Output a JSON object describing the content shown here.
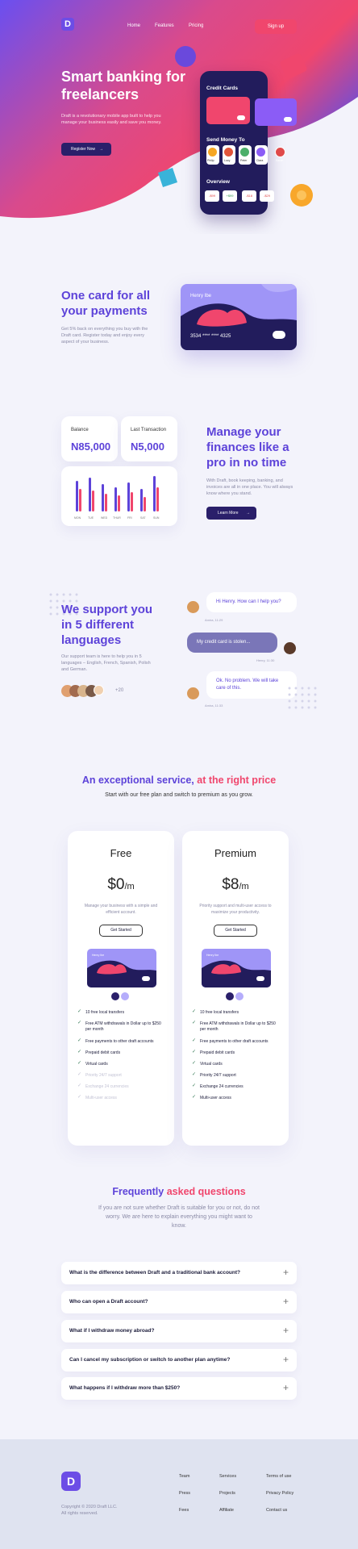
{
  "nav": {
    "logo": "D",
    "links": [
      "Home",
      "Features",
      "Pricing"
    ],
    "signup": "Sign up"
  },
  "hero": {
    "title": "Smart banking for freelancers",
    "desc": "Draft is a revolutionary mobile app built to help you manage your business easily and save you money.",
    "cta": "Register Now",
    "phone": {
      "credit_cards": "Credit Cards",
      "send_money": "Send Money To",
      "contacts": [
        "Philip",
        "Lucy",
        "Peter",
        "Clara",
        "Sarah"
      ],
      "overview": "Overview",
      "overview_vals": [
        "-$99",
        "+$99",
        "-$18",
        "-$29"
      ]
    }
  },
  "payments": {
    "title": "One card for all your payments",
    "desc": "Get 5% back on everything you buy with the Draft card. Register today and enjoy every aspect of your business.",
    "card_name": "Henry Ibe",
    "card_number": "3534 **** **** 4325"
  },
  "finances": {
    "balance_label": "Balance",
    "balance_value": "N85,000",
    "last_label": "Last Transaction",
    "last_value": "N5,000",
    "days": [
      "MON",
      "TUE",
      "WED",
      "THUR",
      "FRI",
      "SAT",
      "SUN"
    ],
    "title": "Manage your finances like a pro in no time",
    "desc": "With Draft, book keeping, banking, and invoices are all in one place. You will always know where you stand.",
    "cta": "Learn More"
  },
  "support": {
    "title": "We support you in 5 different languages",
    "desc": "Our support team is here to help you in 5 languages – English, French, Spanish, Polish and German.",
    "extra_count": "+20",
    "messages": [
      {
        "text": "Hi Henry. How can I help you?",
        "meta": "Amira, 11:29"
      },
      {
        "text": "My credit card is stolen...",
        "meta": "Henry, 11:30"
      },
      {
        "text": "Ok. No problem. We will take care of this.",
        "meta": "Amira, 11:33"
      }
    ]
  },
  "pricing": {
    "title_a": "An exceptional service,",
    "title_b": "at the right price",
    "subtitle": "Start with our free plan and switch to premium as you grow.",
    "plans": [
      {
        "name": "Free",
        "price": "$0",
        "per": "/m",
        "desc": "Manage your business with a simple and efficient account.",
        "cta": "Get Started",
        "card_name": "Henry Ibe",
        "features": [
          {
            "text": "10 free local transfers",
            "on": true
          },
          {
            "text": "Free ATM withdrawals in Dollar up to $250 per month",
            "on": true
          },
          {
            "text": "Free payments to other draft accounts",
            "on": true
          },
          {
            "text": "Prepaid debit cards",
            "on": true
          },
          {
            "text": "Virtual cards",
            "on": true
          },
          {
            "text": "Priority 24/7 support",
            "on": false
          },
          {
            "text": "Exchange 24 currencies",
            "on": false
          },
          {
            "text": "Multi-user access",
            "on": false
          }
        ]
      },
      {
        "name": "Premium",
        "price": "$8",
        "per": "/m",
        "desc": "Priority support and multi-user access to maximize your productivity.",
        "cta": "Get Started",
        "card_name": "Henry Ibe",
        "features": [
          {
            "text": "10 free local transfers",
            "on": true
          },
          {
            "text": "Free ATM withdrawals in Dollar up to $250 per month",
            "on": true
          },
          {
            "text": "Free payments to other draft accounts",
            "on": true
          },
          {
            "text": "Prepaid debit cards",
            "on": true
          },
          {
            "text": "Virtual cards",
            "on": true
          },
          {
            "text": "Priority 24/7 support",
            "on": true
          },
          {
            "text": "Exchange 24 currencies",
            "on": true
          },
          {
            "text": "Multi-user access",
            "on": true
          }
        ]
      }
    ]
  },
  "faq": {
    "title_a": "Frequently",
    "title_b": "asked questions",
    "desc": "If you are not sure whether Draft is suitable for you or not, do not worry. We are here to explain everything you might want to know.",
    "questions": [
      "What is the difference between Draft and a traditional bank account?",
      "Who can open a Draft account?",
      "What if I withdraw money abroad?",
      "Can I cancel my subscription or switch to another plan anytime?",
      "What happens if I withdraw more than $250?"
    ]
  },
  "footer": {
    "logo": "D",
    "copyright": "Copyright © 2020 Draft LLC.",
    "rights": "All rights reserved.",
    "col1": [
      "Team",
      "Press",
      "Fees"
    ],
    "col2": [
      "Services",
      "Projects",
      "Affiliate"
    ],
    "col3": [
      "Terms of use",
      "Privacy Policy",
      "Contact us"
    ]
  },
  "colors": {
    "primary": "#5d43d9",
    "accent": "#f0466d",
    "dark": "#2a1f6a"
  }
}
